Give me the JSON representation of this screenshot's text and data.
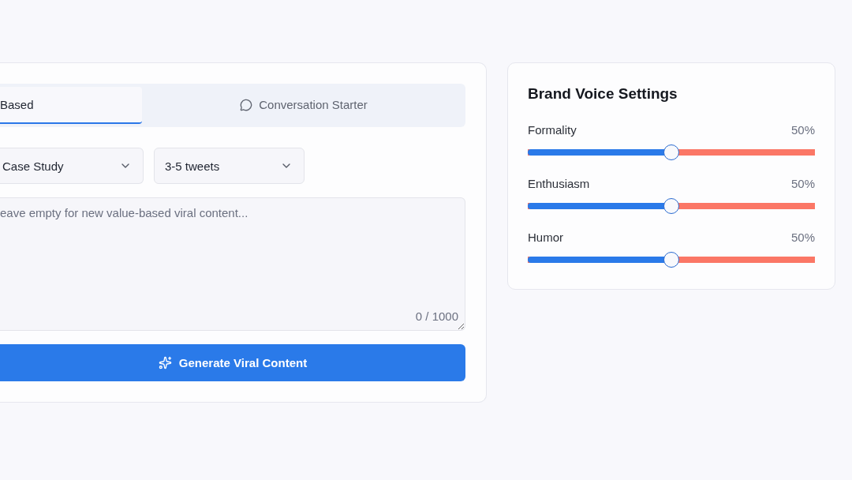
{
  "content_panel": {
    "tabs": [
      {
        "label": "Based",
        "selected": true
      },
      {
        "label": "Conversation Starter",
        "selected": false
      }
    ],
    "selects": [
      {
        "value": "Case Study"
      },
      {
        "value": "3-5 tweets"
      }
    ],
    "prompt": {
      "placeholder": "eave empty for new value-based viral content...",
      "counter": "0 / 1000"
    },
    "generate_button": "Generate Viral Content"
  },
  "brand_voice": {
    "title": "Brand Voice Settings",
    "sliders": [
      {
        "label": "Formality",
        "reading": "50%",
        "level": 0.5
      },
      {
        "label": "Enthusiasm",
        "reading": "50%",
        "level": 0.5
      },
      {
        "label": "Humor",
        "reading": "50%",
        "level": 0.5
      }
    ]
  }
}
